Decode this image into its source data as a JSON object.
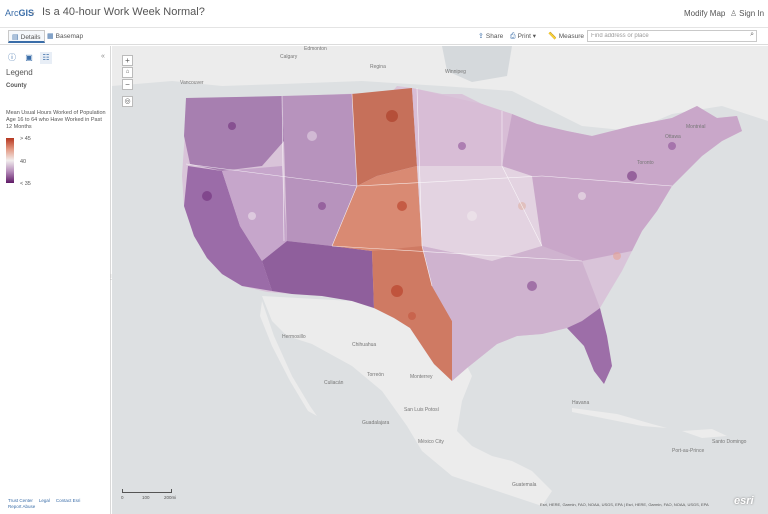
{
  "header": {
    "logo_prefix": "Arc",
    "logo_bold": "GIS",
    "title": "Is a 40-hour Work Week Normal?",
    "modify_map": "Modify Map",
    "sign_in": "Sign In"
  },
  "toolbar": {
    "tab_details": "Details",
    "tab_basemap": "Basemap",
    "share": "Share",
    "print": "Print",
    "measure": "Measure",
    "search_placeholder": "Find address or place"
  },
  "legend": {
    "title": "Legend",
    "layer": "County",
    "field": "Mean Usual Hours Worked of Population Age 16 to 64 who Have Worked in Past 12 Months",
    "high": "> 45",
    "mid": "40",
    "low": "< 35",
    "colors": {
      "high": "#b5361f",
      "mid": "#f1eded",
      "low": "#5f1a66"
    }
  },
  "footer": {
    "links": [
      "Trust Center",
      "Legal",
      "Contact Esri",
      "Report Abuse"
    ]
  },
  "map": {
    "places": [
      "Calgary",
      "Regina",
      "Winnipeg",
      "Vancouver",
      "Edmonton",
      "Ottawa",
      "Montréal",
      "Toronto",
      "Hermosillo",
      "Chihuahua",
      "Monterrey",
      "Culiacán",
      "Torreón",
      "San Luis Potosí",
      "Guadalajara",
      "México City",
      "Havana",
      "Port-au-Prince",
      "Santo Domingo",
      "Guatemala"
    ],
    "scale_labels": [
      "0",
      "100",
      "200mi"
    ],
    "attribution": "Esri, HERE, Garmin, FAO, NOAA, USGS, EPA | Esri, HERE, Garmin, FAO, NOAA, USGS, EPA",
    "watermark": "esri"
  }
}
